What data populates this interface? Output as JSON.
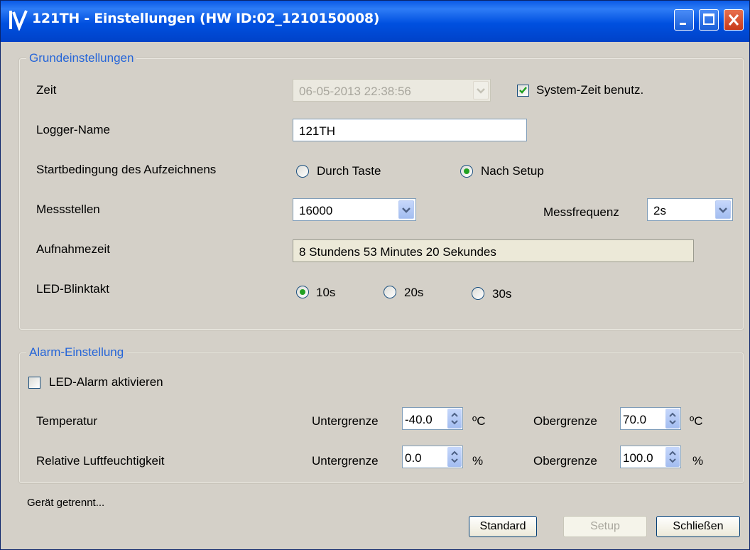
{
  "window": {
    "title": "121TH - Einstellungen (HW ID:02_1210150008)",
    "icons": [
      "app-logo-icon",
      "minimize-icon",
      "maximize-icon",
      "close-icon"
    ]
  },
  "basic": {
    "group_title": "Grundeinstellungen",
    "zeit_label": "Zeit",
    "zeit_value": "06-05-2013 22:38:56",
    "system_time_label": "System-Zeit benutz.",
    "system_time_checked": true,
    "logger_name_label": "Logger-Name",
    "logger_name_value": "121TH",
    "start_label": "Startbedingung des Aufzeichnens",
    "start_options": [
      "Durch Taste",
      "Nach Setup"
    ],
    "start_selected": "Nach Setup",
    "messstellen_label": "Messstellen",
    "messstellen_value": "16000",
    "messfrequenz_label": "Messfrequenz",
    "messfrequenz_value": "2s",
    "aufnahmezeit_label": "Aufnahmezeit",
    "aufnahmezeit_value": "8 Stundens 53 Minutes 20 Sekundes",
    "led_label": "LED-Blinktakt",
    "led_options": [
      "10s",
      "20s",
      "30s"
    ],
    "led_selected": "10s"
  },
  "alarm": {
    "group_title": "Alarm-Einstellung",
    "led_alarm_label": "LED-Alarm aktivieren",
    "led_alarm_checked": false,
    "temp_label": "Temperatur",
    "humidity_label": "Relative Luftfeuchtigkeit",
    "lower_label": "Untergrenze",
    "upper_label": "Obergrenze",
    "temp_lower": "-40.0",
    "temp_upper": "70.0",
    "temp_unit": "ºC",
    "hum_lower": "0.0",
    "hum_upper": "100.0",
    "hum_unit": "%"
  },
  "status": "Gerät getrennt...",
  "buttons": {
    "standard": "Standard",
    "setup": "Setup",
    "close": "Schließen"
  },
  "colors": {
    "titlebar": "#0050e0",
    "group_title": "#2565d8",
    "radio_dot": "#21a121",
    "window_bg": "#d4d0c8"
  }
}
